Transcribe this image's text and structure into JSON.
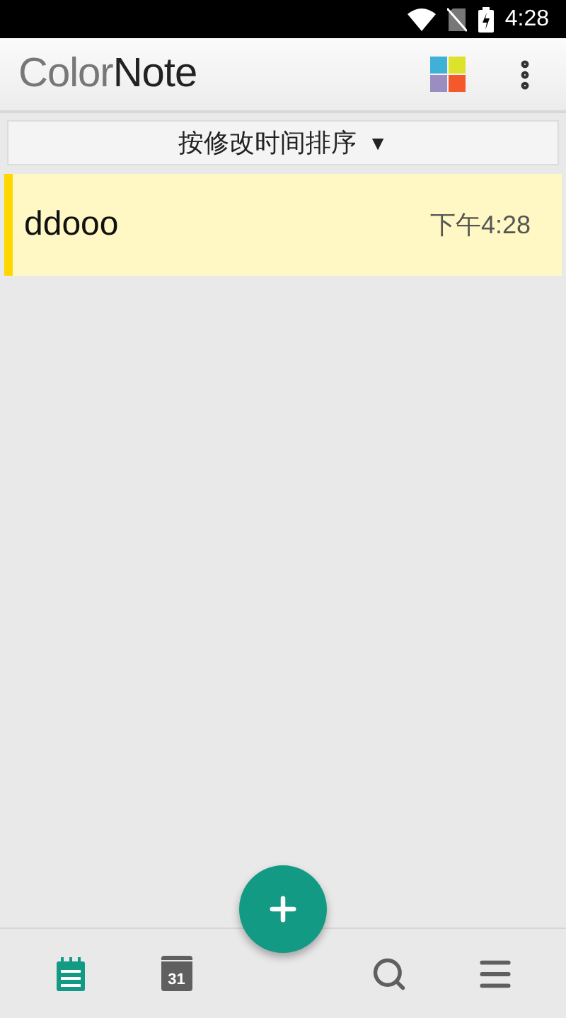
{
  "status_bar": {
    "time": "4:28"
  },
  "app_bar": {
    "logo_left": "Color",
    "logo_right": "Note"
  },
  "sort_bar": {
    "label": "按修改时间排序",
    "caret": "▼"
  },
  "notes": [
    {
      "title": "ddooo",
      "time": "下午4:28",
      "color": "#ffd600"
    }
  ],
  "bottom_nav": [
    {
      "kind": "notes",
      "selected": true
    },
    {
      "kind": "calendar",
      "selected": false,
      "day": "31"
    },
    {
      "kind": "add"
    },
    {
      "kind": "search",
      "selected": false
    },
    {
      "kind": "menu",
      "selected": false
    }
  ]
}
